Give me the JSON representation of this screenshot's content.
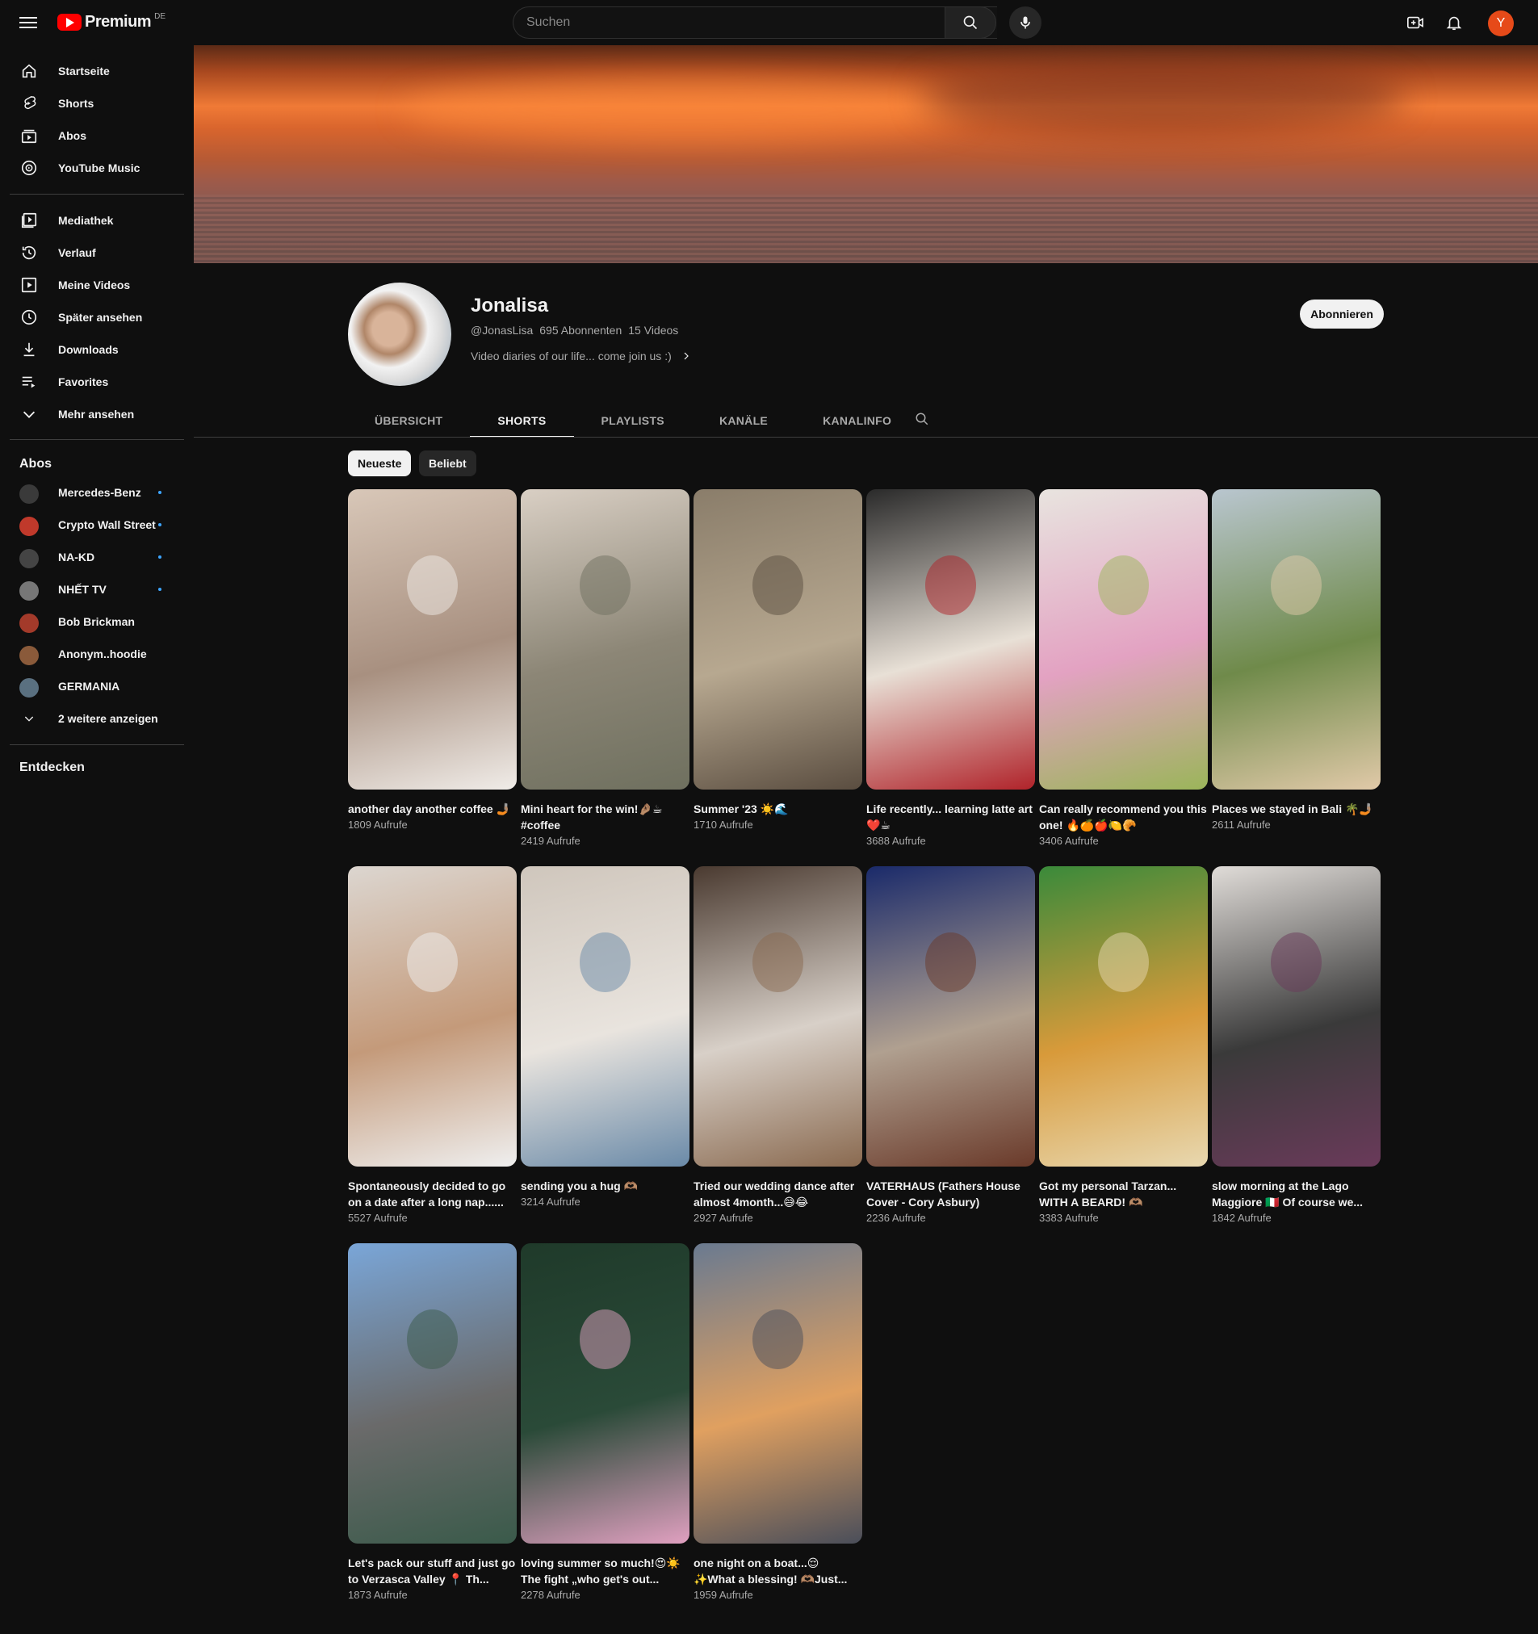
{
  "header": {
    "logo_text": "Premium",
    "country": "DE",
    "search_placeholder": "Suchen",
    "avatar_letter": "Y"
  },
  "sidebar": {
    "main": [
      {
        "label": "Startseite",
        "icon": "home-icon"
      },
      {
        "label": "Shorts",
        "icon": "shorts-icon"
      },
      {
        "label": "Abos",
        "icon": "subscriptions-icon"
      },
      {
        "label": "YouTube Music",
        "icon": "music-icon"
      }
    ],
    "library": [
      {
        "label": "Mediathek",
        "icon": "library-icon"
      },
      {
        "label": "Verlauf",
        "icon": "history-icon"
      },
      {
        "label": "Meine Videos",
        "icon": "my-videos-icon"
      },
      {
        "label": "Später ansehen",
        "icon": "watch-later-icon"
      },
      {
        "label": "Downloads",
        "icon": "download-icon"
      },
      {
        "label": "Favorites",
        "icon": "playlist-icon"
      },
      {
        "label": "Mehr ansehen",
        "icon": "chevron-down-icon"
      }
    ],
    "subs_title": "Abos",
    "subs": [
      {
        "label": "Mercedes-Benz",
        "color": "#3a3a3a",
        "new": true
      },
      {
        "label": "Crypto Wall Street",
        "color": "#c0392b",
        "new": true
      },
      {
        "label": "NA-KD",
        "color": "#444444",
        "new": true
      },
      {
        "label": "NHẾT TV",
        "color": "#777777",
        "new": true
      },
      {
        "label": "Bob Brickman",
        "color": "#a33a2a",
        "new": false
      },
      {
        "label": "Anonym..hoodie",
        "color": "#8a5a3a",
        "new": false
      },
      {
        "label": "GERMANIA",
        "color": "#5a7080",
        "new": false
      }
    ],
    "subs_more": "2 weitere anzeigen",
    "explore_title": "Entdecken"
  },
  "channel": {
    "name": "Jonalisa",
    "handle": "@JonasLisa",
    "subscribers": "695 Abonnenten",
    "videos": "15 Videos",
    "description": "Video diaries of our life... come join us :)",
    "subscribe_label": "Abonnieren"
  },
  "tabs": [
    {
      "label": "ÜBERSICHT",
      "active": false
    },
    {
      "label": "SHORTS",
      "active": true
    },
    {
      "label": "PLAYLISTS",
      "active": false
    },
    {
      "label": "KANÄLE",
      "active": false
    },
    {
      "label": "KANALINFO",
      "active": false
    }
  ],
  "chips": [
    {
      "label": "Neueste",
      "active": true
    },
    {
      "label": "Beliebt",
      "active": false
    }
  ],
  "shorts": [
    {
      "title": "another day another coffee 🤳🏽",
      "views": "1809 Aufrufe",
      "colors": [
        "#d8c7b8",
        "#a89080",
        "#f0ece8"
      ]
    },
    {
      "title": "Mini heart for the win!🤌🏽☕ #coffee",
      "views": "2419 Aufrufe",
      "colors": [
        "#d9cfc4",
        "#8c8676",
        "#6f705f"
      ]
    },
    {
      "title": "Summer '23 ☀️🌊",
      "views": "1710 Aufrufe",
      "colors": [
        "#8a7d6a",
        "#b7a890",
        "#5a4d40"
      ]
    },
    {
      "title": "Life recently... learning latte art❤️☕",
      "views": "3688 Aufrufe",
      "colors": [
        "#2a2a2a",
        "#e8e0d6",
        "#b0232a"
      ]
    },
    {
      "title": "Can really recommend you this one! 🔥🍊🍎🍋🥐",
      "views": "3406 Aufrufe",
      "colors": [
        "#e8e4df",
        "#e3a2c2",
        "#9bb55a"
      ]
    },
    {
      "title": "Places we stayed in Bali 🌴🤳🏽",
      "views": "2611 Aufrufe",
      "colors": [
        "#b9c6cf",
        "#6f8a4a",
        "#e0c9a8"
      ]
    },
    {
      "title": "Spontaneously decided to go on a date after a long nap......",
      "views": "5527 Aufrufe",
      "colors": [
        "#dcd6d0",
        "#c49a7a",
        "#efefef"
      ]
    },
    {
      "title": "sending you a hug 🫶🏽",
      "views": "3214 Aufrufe",
      "colors": [
        "#cfc6bc",
        "#e9e4de",
        "#6a8aa8"
      ]
    },
    {
      "title": "Tried our wedding dance after almost 4month...😅😂",
      "views": "2927 Aufrufe",
      "colors": [
        "#4a3a30",
        "#d8d0c8",
        "#8a6a50"
      ]
    },
    {
      "title": "VATERHAUS (Fathers House Cover - Cory Asbury)",
      "views": "2236 Aufrufe",
      "colors": [
        "#1a2a6a",
        "#b0a090",
        "#6a3a2a"
      ]
    },
    {
      "title": "Got my personal Tarzan... WITH A BEARD! 🫶🏽",
      "views": "3383 Aufrufe",
      "colors": [
        "#3a8a3a",
        "#d89a3a",
        "#e8d8b0"
      ]
    },
    {
      "title": "slow morning at the Lago Maggiore 🇮🇹 Of course we...",
      "views": "1842 Aufrufe",
      "colors": [
        "#e0dcd8",
        "#3a3a3a",
        "#6a3a5a"
      ]
    },
    {
      "title": "Let's pack our stuff and just go to Verzasca Valley 📍 Th...",
      "views": "1873 Aufrufe",
      "colors": [
        "#7aa6d8",
        "#6a6a6a",
        "#3a5a4a"
      ]
    },
    {
      "title": "loving summer so much!😍☀️ The fight „who get's out...",
      "views": "2278 Aufrufe",
      "colors": [
        "#1f3a2a",
        "#2a4a38",
        "#e0a0c0"
      ]
    },
    {
      "title": "one night on a boat...😌 ✨What a blessing! 🫶🏽Just...",
      "views": "1959 Aufrufe",
      "colors": [
        "#6a7a90",
        "#e0a060",
        "#4a4e5a"
      ]
    }
  ]
}
